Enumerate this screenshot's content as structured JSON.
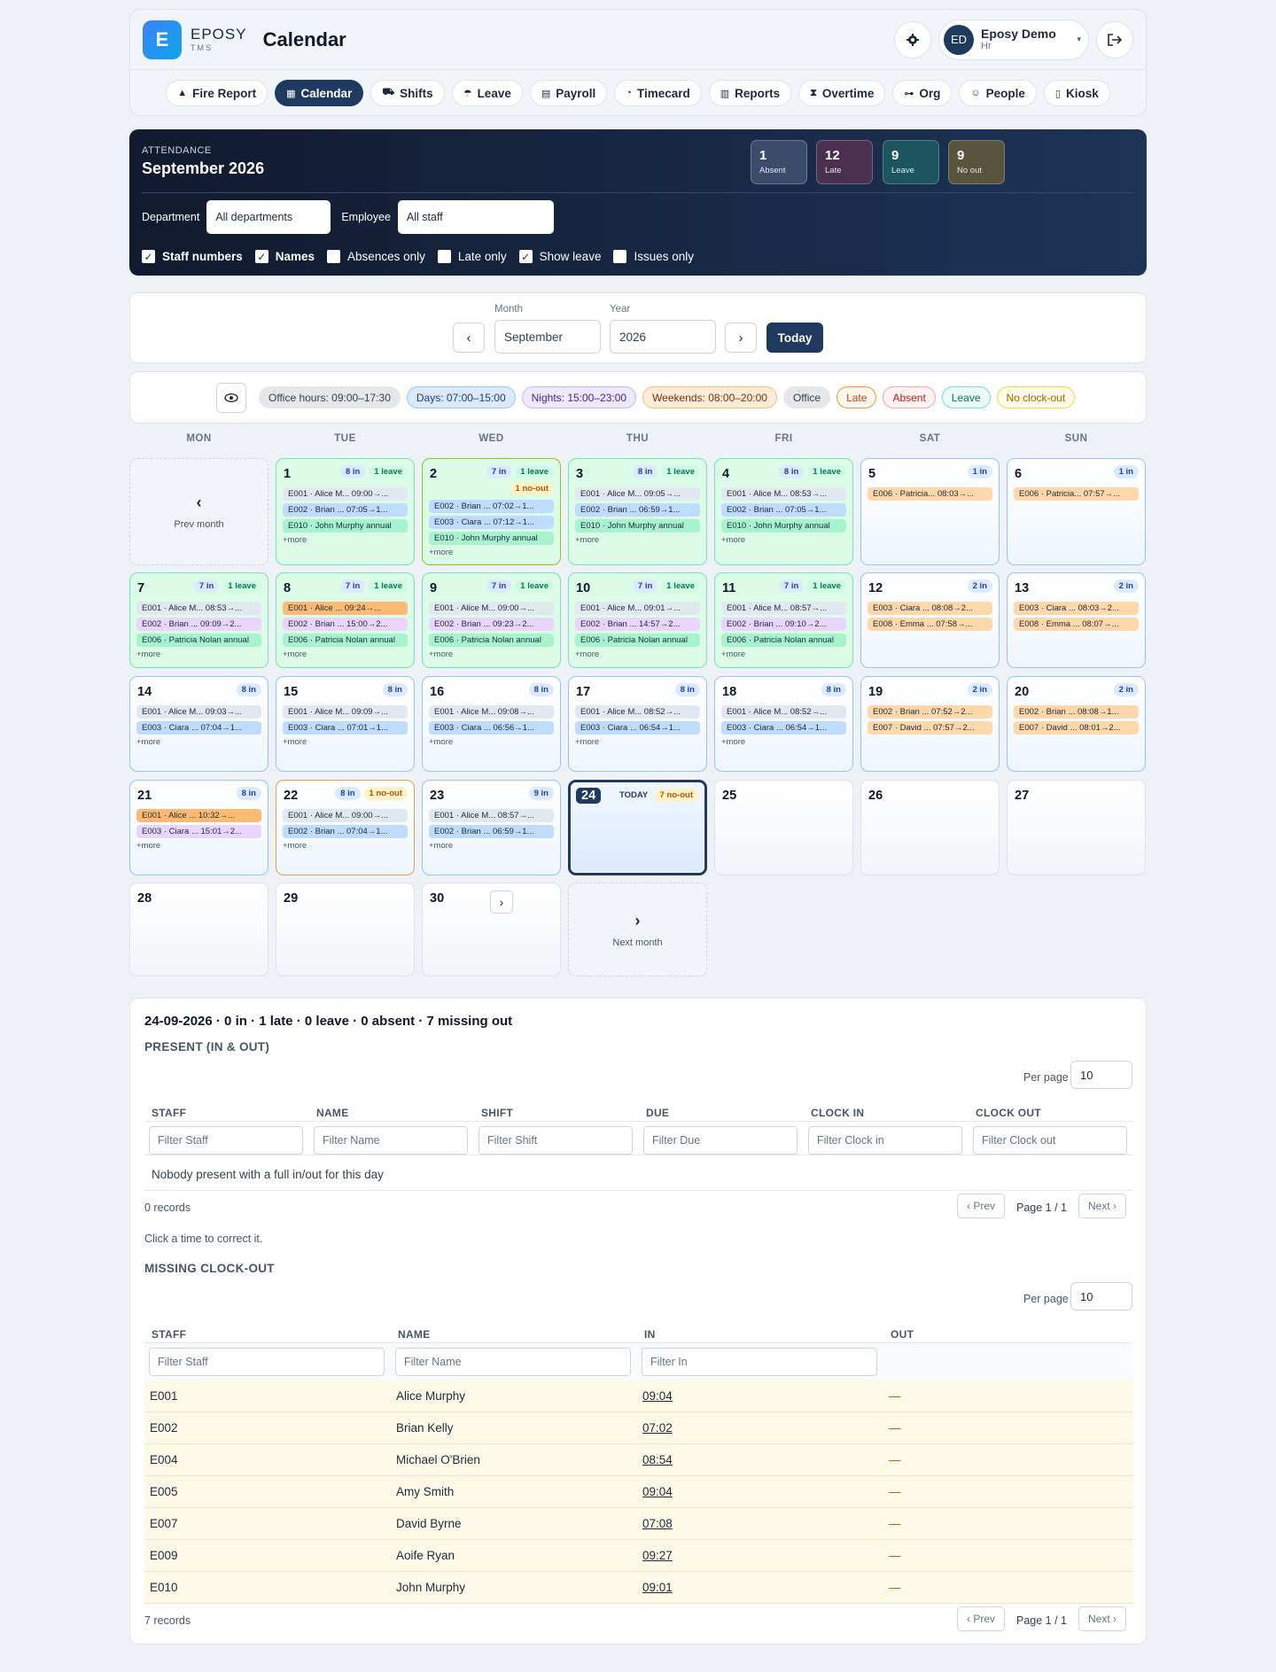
{
  "header": {
    "logo_letter": "E",
    "brand": "EPOSY",
    "brand_sub": "TMS",
    "title": "Calendar",
    "user_initials": "ED",
    "user_name": "Eposy Demo",
    "user_role": "Hr",
    "nav": [
      {
        "label": "Fire Report",
        "icon": "fire-icon"
      },
      {
        "label": "Calendar",
        "icon": "calendar-icon",
        "active": true
      },
      {
        "label": "Shifts",
        "icon": "shifts-icon"
      },
      {
        "label": "Leave",
        "icon": "umbrella-icon"
      },
      {
        "label": "Payroll",
        "icon": "document-icon"
      },
      {
        "label": "Timecard",
        "icon": "stopwatch-icon"
      },
      {
        "label": "Reports",
        "icon": "chart-icon"
      },
      {
        "label": "Overtime",
        "icon": "hourglass-icon"
      },
      {
        "label": "Org",
        "icon": "org-icon"
      },
      {
        "label": "People",
        "icon": "people-icon"
      },
      {
        "label": "Kiosk",
        "icon": "tablet-icon"
      }
    ]
  },
  "attendance": {
    "label": "ATTENDANCE",
    "month": "September 2026",
    "stats": [
      {
        "value": "1",
        "label": "Absent",
        "color": "#3b4c6b"
      },
      {
        "value": "12",
        "label": "Late",
        "color": "#4a2f4f"
      },
      {
        "value": "9",
        "label": "Leave",
        "color": "#1c5560"
      },
      {
        "value": "9",
        "label": "No out",
        "color": "#58533c"
      }
    ],
    "department_label": "Department",
    "department_value": "All departments",
    "employee_label": "Employee",
    "employee_value": "All staff",
    "checks": [
      {
        "label": "Staff numbers",
        "checked": true
      },
      {
        "label": "Names",
        "checked": true
      },
      {
        "label": "Absences only",
        "checked": false
      },
      {
        "label": "Late only",
        "checked": false
      },
      {
        "label": "Show leave",
        "checked": true
      },
      {
        "label": "Issues only",
        "checked": false
      }
    ]
  },
  "picker": {
    "month_label": "Month",
    "month_value": "September",
    "year_label": "Year",
    "year_value": "2026",
    "prev": "‹",
    "next": "›",
    "today": "Today"
  },
  "legend": [
    {
      "label": "Office hours: 09:00–17:30",
      "bg": "#e5e7eb",
      "border": "#e5e7eb",
      "fg": "#334155"
    },
    {
      "label": "Days: 07:00–15:00",
      "bg": "#dbeafe",
      "border": "#93c5fd",
      "fg": "#1e3a8a"
    },
    {
      "label": "Nights: 15:00–23:00",
      "bg": "#ede9fe",
      "border": "#c4b5fd",
      "fg": "#4c1d95"
    },
    {
      "label": "Weekends: 08:00–20:00",
      "bg": "#ffedd5",
      "border": "#fdba74",
      "fg": "#7c2d12"
    },
    {
      "label": "Office",
      "bg": "#e5e7eb",
      "border": "#e5e7eb",
      "fg": "#334155"
    },
    {
      "label": "Late",
      "bg": "#fff7ed",
      "border": "#fb923c",
      "fg": "#c2410c"
    },
    {
      "label": "Absent",
      "bg": "#fef2f2",
      "border": "#fca5a5",
      "fg": "#b91c1c"
    },
    {
      "label": "Leave",
      "bg": "#ecfdf5",
      "border": "#6ee7b7",
      "fg": "#047857"
    },
    {
      "label": "No clock-out",
      "bg": "#fefce8",
      "border": "#fcd34d",
      "fg": "#a16207"
    }
  ],
  "calendar": {
    "weekdays": [
      "MON",
      "TUE",
      "WED",
      "THU",
      "FRI",
      "SAT",
      "SUN"
    ],
    "prev_month": "Prev month",
    "next_month": "Next month",
    "today_tag": "TODAY",
    "days": [
      {
        "d": "1",
        "style": "green",
        "badges": [
          [
            "8 in",
            "in"
          ],
          [
            "1 leave",
            "lv"
          ]
        ],
        "entries": [
          [
            "E001 · Alice M... 09:00→...",
            "gray"
          ],
          [
            "E002 · Brian ... 07:05→1...",
            "blue"
          ],
          [
            "E010 · John Murphy annual",
            "green"
          ]
        ],
        "more": "+more"
      },
      {
        "d": "2",
        "style": "green",
        "badges": [
          [
            "7 in",
            "in"
          ],
          [
            "1 leave",
            "lv"
          ],
          [
            "1 no-out",
            "no"
          ]
        ],
        "entries": [
          [
            "E002 · Brian ... 07:02→1...",
            "blue"
          ],
          [
            "E003 · Ciara ... 07:12→1...",
            "blue"
          ],
          [
            "E010 · John Murphy annual",
            "green"
          ]
        ],
        "more": "+more"
      },
      {
        "d": "3",
        "style": "green",
        "badges": [
          [
            "8 in",
            "in"
          ],
          [
            "1 leave",
            "lv"
          ]
        ],
        "entries": [
          [
            "E001 · Alice M... 09:05→...",
            "gray"
          ],
          [
            "E002 · Brian ... 06:59→1...",
            "blue"
          ],
          [
            "E010 · John Murphy annual",
            "green"
          ]
        ],
        "more": "+more"
      },
      {
        "d": "4",
        "style": "green",
        "badges": [
          [
            "8 in",
            "in"
          ],
          [
            "1 leave",
            "lv"
          ]
        ],
        "entries": [
          [
            "E001 · Alice M... 08:53→...",
            "gray"
          ],
          [
            "E002 · Brian ... 07:05→1...",
            "blue"
          ],
          [
            "E010 · John Murphy annual",
            "green"
          ]
        ],
        "more": "+more"
      },
      {
        "d": "5",
        "style": "blue",
        "badges": [
          [
            "1 in",
            "in"
          ]
        ],
        "entries": [
          [
            "E006 · Patricia... 08:03→...",
            "orange"
          ]
        ],
        "more": ""
      },
      {
        "d": "6",
        "style": "blue",
        "badges": [
          [
            "1 in",
            "in"
          ]
        ],
        "entries": [
          [
            "E006 · Patricia... 07:57→...",
            "orange"
          ]
        ],
        "more": ""
      },
      {
        "d": "7",
        "style": "green",
        "badges": [
          [
            "7 in",
            "in"
          ],
          [
            "1 leave",
            "lv"
          ]
        ],
        "entries": [
          [
            "E001 · Alice M... 08:53→...",
            "gray"
          ],
          [
            "E002 · Brian ... 09:09→2...",
            "purple"
          ],
          [
            "E006 · Patricia Nolan annual",
            "green"
          ]
        ],
        "more": "+more"
      },
      {
        "d": "8",
        "style": "green",
        "badges": [
          [
            "7 in",
            "in"
          ],
          [
            "1 leave",
            "lv"
          ]
        ],
        "entries": [
          [
            "E001 · Alice ... 09:24→...",
            "dorange"
          ],
          [
            "E002 · Brian ... 15:00→2...",
            "purple"
          ],
          [
            "E006 · Patricia Nolan annual",
            "green"
          ]
        ],
        "more": "+more"
      },
      {
        "d": "9",
        "style": "green",
        "badges": [
          [
            "7 in",
            "in"
          ],
          [
            "1 leave",
            "lv"
          ]
        ],
        "entries": [
          [
            "E001 · Alice M... 09:00→...",
            "gray"
          ],
          [
            "E002 · Brian ... 09:23→2...",
            "purple"
          ],
          [
            "E006 · Patricia Nolan annual",
            "green"
          ]
        ],
        "more": "+more"
      },
      {
        "d": "10",
        "style": "green",
        "badges": [
          [
            "7 in",
            "in"
          ],
          [
            "1 leave",
            "lv"
          ]
        ],
        "entries": [
          [
            "E001 · Alice M... 09:01→...",
            "gray"
          ],
          [
            "E002 · Brian ... 14:57→2...",
            "purple"
          ],
          [
            "E006 · Patricia Nolan annual",
            "green"
          ]
        ],
        "more": "+more"
      },
      {
        "d": "11",
        "style": "green",
        "badges": [
          [
            "7 in",
            "in"
          ],
          [
            "1 leave",
            "lv"
          ]
        ],
        "entries": [
          [
            "E001 · Alice M... 08:57→...",
            "gray"
          ],
          [
            "E002 · Brian ... 09:10→2...",
            "purple"
          ],
          [
            "E006 · Patricia Nolan annual",
            "green"
          ]
        ],
        "more": "+more"
      },
      {
        "d": "12",
        "style": "blue",
        "badges": [
          [
            "2 in",
            "in"
          ]
        ],
        "entries": [
          [
            "E003 · Ciara ... 08:08→2...",
            "orange"
          ],
          [
            "E008 · Emma ... 07:58→...",
            "orange"
          ]
        ],
        "more": ""
      },
      {
        "d": "13",
        "style": "blue",
        "badges": [
          [
            "2 in",
            "in"
          ]
        ],
        "entries": [
          [
            "E003 · Ciara ... 08:03→2...",
            "orange"
          ],
          [
            "E008 · Emma ... 08:07→...",
            "orange"
          ]
        ],
        "more": ""
      },
      {
        "d": "14",
        "style": "blue",
        "badges": [
          [
            "8 in",
            "in"
          ]
        ],
        "entries": [
          [
            "E001 · Alice M... 09:03→...",
            "gray"
          ],
          [
            "E003 · Ciara ... 07:04→1...",
            "blue"
          ]
        ],
        "more": "+more"
      },
      {
        "d": "15",
        "style": "blue",
        "badges": [
          [
            "8 in",
            "in"
          ]
        ],
        "entries": [
          [
            "E001 · Alice M... 09:09→...",
            "gray"
          ],
          [
            "E003 · Ciara ... 07:01→1...",
            "blue"
          ]
        ],
        "more": "+more"
      },
      {
        "d": "16",
        "style": "blue",
        "badges": [
          [
            "8 in",
            "in"
          ]
        ],
        "entries": [
          [
            "E001 · Alice M... 09:08→...",
            "gray"
          ],
          [
            "E003 · Ciara ... 06:56→1...",
            "blue"
          ]
        ],
        "more": "+more"
      },
      {
        "d": "17",
        "style": "blue",
        "badges": [
          [
            "8 in",
            "in"
          ]
        ],
        "entries": [
          [
            "E001 · Alice M... 08:52→...",
            "gray"
          ],
          [
            "E003 · Ciara ... 06:54→1...",
            "blue"
          ]
        ],
        "more": "+more"
      },
      {
        "d": "18",
        "style": "blue",
        "badges": [
          [
            "8 in",
            "in"
          ]
        ],
        "entries": [
          [
            "E001 · Alice M... 08:52→...",
            "gray"
          ],
          [
            "E003 · Ciara ... 06:54→1...",
            "blue"
          ]
        ],
        "more": "+more"
      },
      {
        "d": "19",
        "style": "blue",
        "badges": [
          [
            "2 in",
            "in"
          ]
        ],
        "entries": [
          [
            "E002 · Brian ... 07:52→2...",
            "orange"
          ],
          [
            "E007 · David ... 07:57→2...",
            "orange"
          ]
        ],
        "more": ""
      },
      {
        "d": "20",
        "style": "blue",
        "badges": [
          [
            "2 in",
            "in"
          ]
        ],
        "entries": [
          [
            "E002 · Brian ... 08:08→1...",
            "orange"
          ],
          [
            "E007 · David ... 08:01→2...",
            "orange"
          ]
        ],
        "more": ""
      },
      {
        "d": "21",
        "style": "blue",
        "badges": [
          [
            "8 in",
            "in"
          ]
        ],
        "entries": [
          [
            "E001 · Alice ... 10:32→...",
            "dorange"
          ],
          [
            "E003 · Ciara ... 15:01→2...",
            "purple"
          ]
        ],
        "more": "+more"
      },
      {
        "d": "22",
        "style": "blue",
        "badges": [
          [
            "8 in",
            "in"
          ],
          [
            "1 no-out",
            "no"
          ]
        ],
        "entries": [
          [
            "E001 · Alice M... 09:00→...",
            "gray"
          ],
          [
            "E002 · Brian ... 07:04→1...",
            "blue"
          ]
        ],
        "more": "+more"
      },
      {
        "d": "23",
        "style": "blue",
        "badges": [
          [
            "9 in",
            "in"
          ]
        ],
        "entries": [
          [
            "E001 · Alice M... 08:57→...",
            "gray"
          ],
          [
            "E002 · Brian ... 06:59→1...",
            "blue"
          ]
        ],
        "more": "+more"
      },
      {
        "d": "24",
        "style": "today",
        "badges": [
          [
            "7 no-out",
            "no"
          ]
        ],
        "entries": [],
        "more": ""
      },
      {
        "d": "25",
        "style": "plain",
        "badges": [],
        "entries": [],
        "more": ""
      },
      {
        "d": "26",
        "style": "plain",
        "badges": [],
        "entries": [],
        "more": ""
      },
      {
        "d": "27",
        "style": "plain",
        "badges": [],
        "entries": [],
        "more": ""
      },
      {
        "d": "28",
        "style": "plain",
        "badges": [],
        "entries": [],
        "more": ""
      },
      {
        "d": "29",
        "style": "plain",
        "badges": [],
        "entries": [],
        "more": ""
      },
      {
        "d": "30",
        "style": "plain",
        "badges": [],
        "entries": [],
        "more": ""
      }
    ]
  },
  "day_detail": {
    "summary": "24-09-2026 · 0 in · 1 late · 0 leave · 0 absent · 7 missing out",
    "present_title": "PRESENT (IN & OUT)",
    "per_page_label": "Per page",
    "per_page_value": "10",
    "present_columns": [
      "STAFF",
      "NAME",
      "SHIFT",
      "DUE",
      "CLOCK IN",
      "CLOCK OUT"
    ],
    "present_filters": [
      "Filter Staff",
      "Filter Name",
      "Filter Shift",
      "Filter Due",
      "Filter Clock in",
      "Filter Clock out"
    ],
    "present_empty": "Nobody present with a full in/out for this day",
    "present_records": "0 records",
    "prev": "‹ Prev",
    "next": "Next ›",
    "page_info": "Page 1 / 1",
    "hint": "Click a time to correct it.",
    "missing_title": "MISSING CLOCK-OUT",
    "missing_columns": [
      "STAFF",
      "NAME",
      "IN",
      "OUT"
    ],
    "missing_filters": [
      "Filter Staff",
      "Filter Name",
      "Filter In"
    ],
    "missing_rows": [
      [
        "E001",
        "Alice Murphy",
        "09:04",
        "—"
      ],
      [
        "E002",
        "Brian Kelly",
        "07:02",
        "—"
      ],
      [
        "E004",
        "Michael O'Brien",
        "08:54",
        "—"
      ],
      [
        "E005",
        "Amy Smith",
        "09:04",
        "—"
      ],
      [
        "E007",
        "David Byrne",
        "07:08",
        "—"
      ],
      [
        "E009",
        "Aoife Ryan",
        "09:27",
        "—"
      ],
      [
        "E010",
        "John Murphy",
        "09:01",
        "—"
      ]
    ],
    "missing_records": "7 records"
  }
}
